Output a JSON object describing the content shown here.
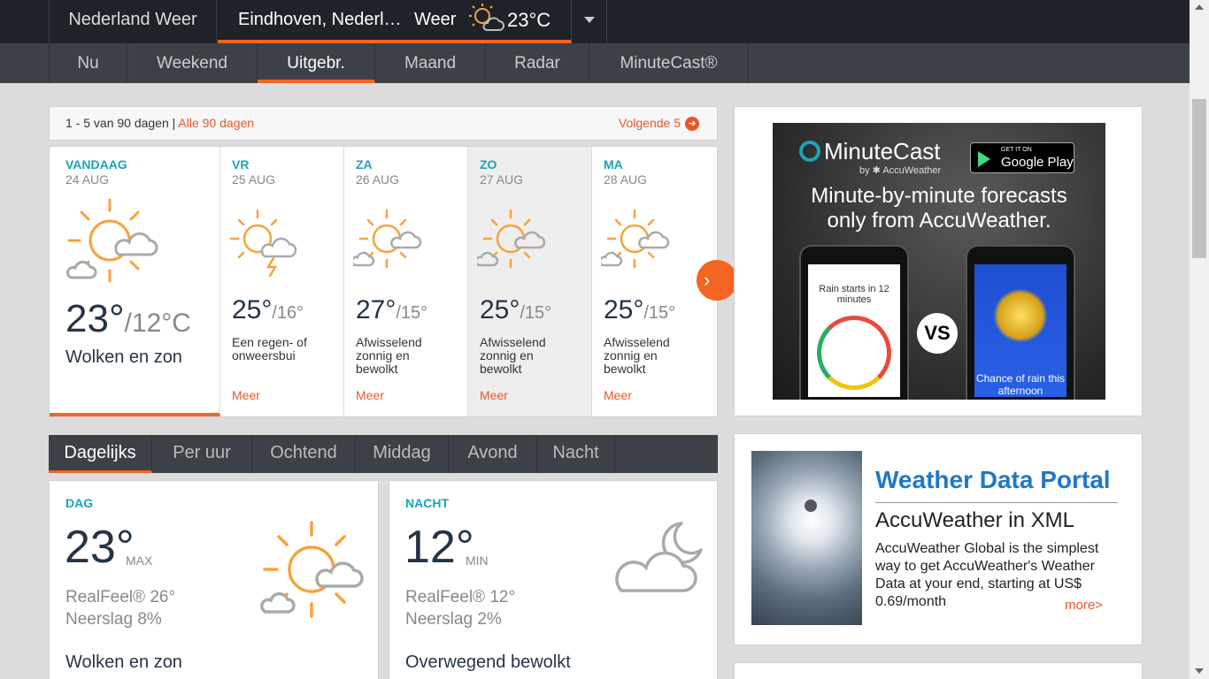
{
  "header": {
    "country": "Nederland Weer",
    "location": "Eindhoven, Nederl…",
    "weather_label": "Weer",
    "current_temp": "23°C"
  },
  "subnav": [
    {
      "label": "Nu",
      "active": false
    },
    {
      "label": "Weekend",
      "active": false
    },
    {
      "label": "Uitgebr.",
      "active": true
    },
    {
      "label": "Maand",
      "active": false
    },
    {
      "label": "Radar",
      "active": false
    },
    {
      "label": "MinuteCast®",
      "active": false
    }
  ],
  "pager": {
    "range": "1 - 5 van 90 dagen",
    "separator": "|",
    "all_link": "Alle 90 dagen",
    "next": "Volgende 5"
  },
  "days": [
    {
      "name": "VANDAAG",
      "date": "24 AUG",
      "hi": "23°",
      "lo": "/12°C",
      "desc": "Wolken en zon",
      "more": "",
      "icon": "sun-cloud-icon"
    },
    {
      "name": "VR",
      "date": "25 AUG",
      "hi": "25°",
      "lo": "/16°",
      "desc": "Een regen- of onweersbui",
      "more": "Meer",
      "icon": "thunderstorm-icon"
    },
    {
      "name": "ZA",
      "date": "26 AUG",
      "hi": "27°",
      "lo": "/15°",
      "desc": "Afwisselend zonnig en bewolkt",
      "more": "Meer",
      "icon": "sun-cloud-icon"
    },
    {
      "name": "ZO",
      "date": "27 AUG",
      "hi": "25°",
      "lo": "/15°",
      "desc": "Afwisselend zonnig en bewolkt",
      "more": "Meer",
      "icon": "sun-cloud-icon"
    },
    {
      "name": "MA",
      "date": "28 AUG",
      "hi": "25°",
      "lo": "/15°",
      "desc": "Afwisselend zonnig en bewolkt",
      "more": "Meer",
      "icon": "sun-cloud-icon"
    }
  ],
  "tabs": [
    {
      "label": "Dagelijks",
      "active": true
    },
    {
      "label": "Per uur",
      "active": false
    },
    {
      "label": "Ochtend",
      "active": false
    },
    {
      "label": "Middag",
      "active": false
    },
    {
      "label": "Avond",
      "active": false
    },
    {
      "label": "Nacht",
      "active": false
    }
  ],
  "day_panel": {
    "label": "DAG",
    "temp": "23°",
    "unit": "MAX",
    "realfeel": "RealFeel® 26°",
    "precip": "Neerslag 8%",
    "desc": "Wolken en zon",
    "icon": "sun-cloud-icon"
  },
  "night_panel": {
    "label": "NACHT",
    "temp": "12°",
    "unit": "MIN",
    "realfeel": "RealFeel® 12°",
    "precip": "Neerslag 2%",
    "desc": "Overwegend bewolkt",
    "icon": "moon-cloud-icon"
  },
  "ad_minutecast": {
    "logo": "MinuteCast",
    "by": "by ✱ AccuWeather",
    "store_small": "GET IT ON",
    "store": "Google Play",
    "headline1": "Minute-by-minute forecasts",
    "headline2": "only from AccuWeather.",
    "rain_starts": "Rain starts in 12 minutes",
    "vs": "VS",
    "chance": "Chance of rain this afternoon"
  },
  "ad_portal": {
    "title": "Weather Data Portal",
    "subtitle": "AccuWeather in XML",
    "body": "AccuWeather Global is the simplest way to get AccuWeather's Weather Data at your end, starting at US$ 0.69/month",
    "more": "more>"
  },
  "colors": {
    "accent": "#f26522",
    "teal": "#1aa3b8",
    "dark": "#1f2329",
    "navy_text": "#243447"
  }
}
